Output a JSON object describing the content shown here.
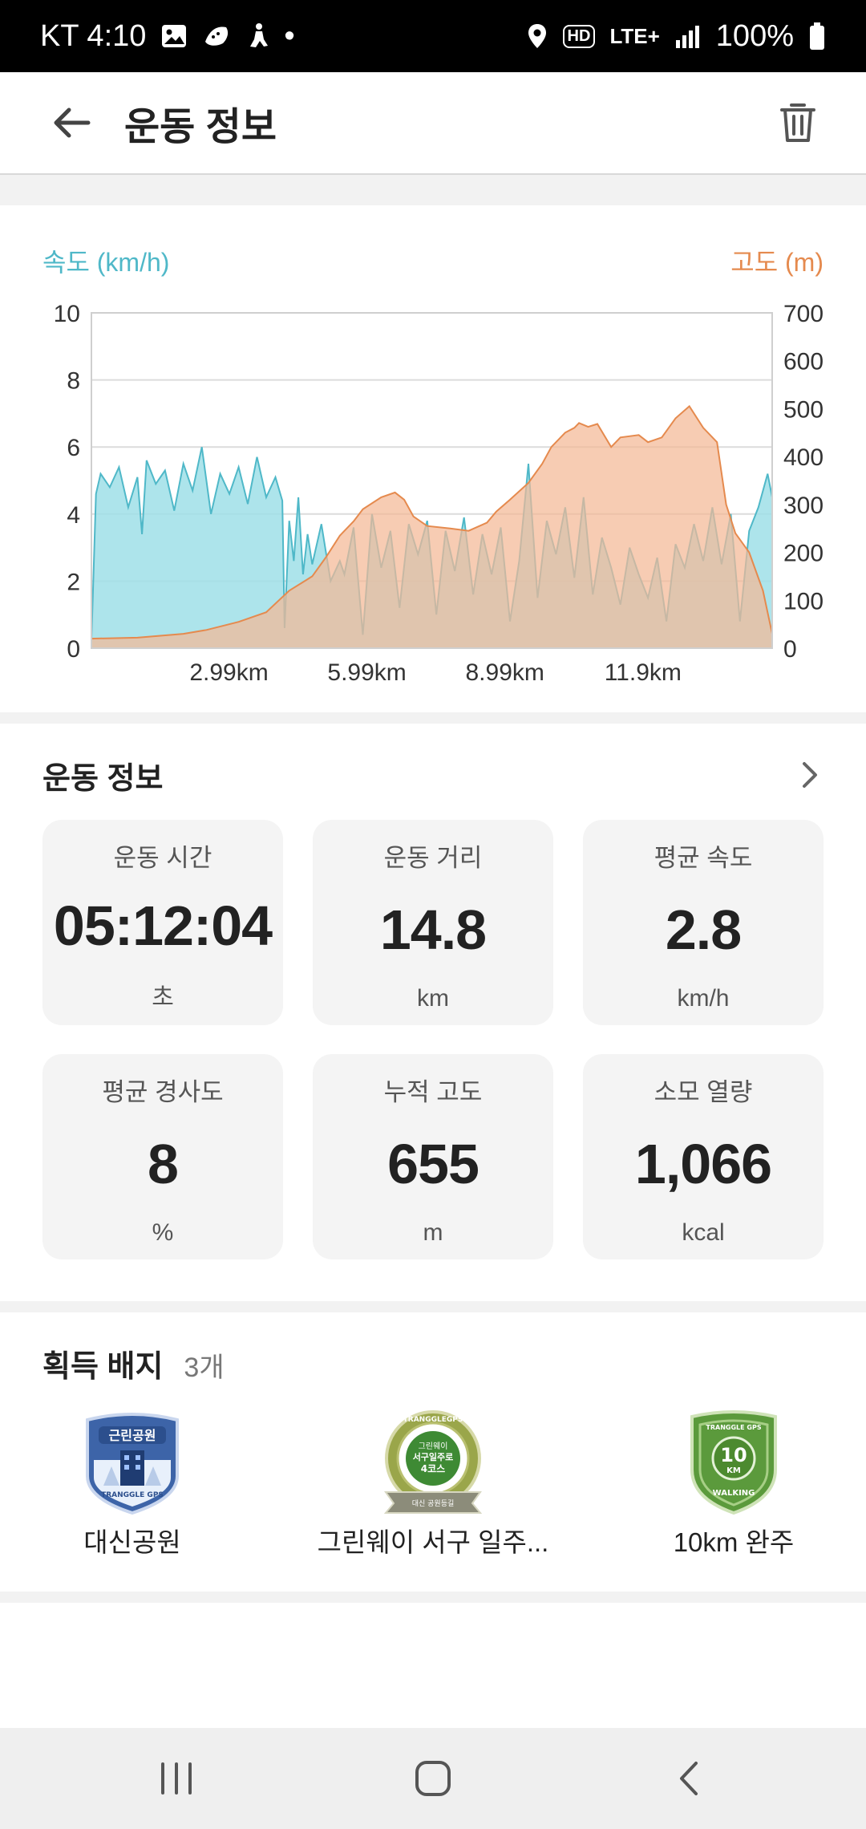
{
  "status_bar": {
    "carrier_time": "KT 4:10",
    "dot": "•",
    "hd": "HD",
    "network": "LTE+",
    "battery": "100%"
  },
  "header": {
    "title": "운동 정보"
  },
  "chart_data": {
    "type": "area",
    "x_tick_labels": [
      "2.99km",
      "5.99km",
      "8.99km",
      "11.9km"
    ],
    "x_tick_positions": [
      2.99,
      5.99,
      8.99,
      11.99
    ],
    "xlim": [
      0,
      14.8
    ],
    "left_axis": {
      "label": "속도 (km/h)",
      "ylim": [
        0,
        10
      ],
      "ticks": [
        "0",
        "2",
        "4",
        "6",
        "8",
        "10"
      ],
      "color": "#4fb8c8"
    },
    "right_axis": {
      "label": "고도 (m)",
      "ylim": [
        0,
        700
      ],
      "ticks": [
        "0",
        "100",
        "200",
        "300",
        "400",
        "500",
        "600",
        "700"
      ],
      "color": "#e58a4e"
    },
    "grid": true,
    "series": [
      {
        "axis": "left",
        "color": "#9fdfe7",
        "x": [
          0,
          0.1,
          0.2,
          0.4,
          0.6,
          0.8,
          1.0,
          1.1,
          1.2,
          1.4,
          1.6,
          1.8,
          2.0,
          2.2,
          2.4,
          2.6,
          2.8,
          3.0,
          3.2,
          3.4,
          3.6,
          3.8,
          4.0,
          4.15,
          4.2,
          4.3,
          4.4,
          4.5,
          4.6,
          4.7,
          4.8,
          5.0,
          5.2,
          5.4,
          5.5,
          5.7,
          5.9,
          6.1,
          6.3,
          6.5,
          6.7,
          6.9,
          7.1,
          7.3,
          7.5,
          7.7,
          7.9,
          8.1,
          8.3,
          8.5,
          8.7,
          8.9,
          9.1,
          9.3,
          9.5,
          9.7,
          9.9,
          10.1,
          10.3,
          10.5,
          10.7,
          10.9,
          11.1,
          11.3,
          11.5,
          11.7,
          11.9,
          12.1,
          12.3,
          12.5,
          12.7,
          12.9,
          13.1,
          13.3,
          13.5,
          13.7,
          13.9,
          14.1,
          14.3,
          14.5,
          14.7,
          14.8
        ],
        "values": [
          0.2,
          4.6,
          5.2,
          4.8,
          5.4,
          4.2,
          5.1,
          3.4,
          5.6,
          4.9,
          5.3,
          4.1,
          5.5,
          4.7,
          6.0,
          4.0,
          5.2,
          4.6,
          5.4,
          4.3,
          5.7,
          4.5,
          5.1,
          4.4,
          0.6,
          3.8,
          2.6,
          4.5,
          2.2,
          3.4,
          2.5,
          3.7,
          2.0,
          2.6,
          2.2,
          3.6,
          0.4,
          4.0,
          2.4,
          3.5,
          1.2,
          3.7,
          2.8,
          3.8,
          1.0,
          3.5,
          2.3,
          3.9,
          1.6,
          3.4,
          2.2,
          3.6,
          0.8,
          2.6,
          5.5,
          1.5,
          3.8,
          2.8,
          4.2,
          2.1,
          4.5,
          1.6,
          3.3,
          2.4,
          1.3,
          3.0,
          2.2,
          1.5,
          2.7,
          0.8,
          3.1,
          2.4,
          3.7,
          2.6,
          4.2,
          2.5,
          4.0,
          0.8,
          3.5,
          4.2,
          5.2,
          4.5
        ]
      },
      {
        "axis": "right",
        "color": "#f4b995",
        "x": [
          0,
          1.0,
          2.0,
          2.5,
          3.2,
          3.8,
          4.3,
          4.8,
          5.1,
          5.4,
          5.7,
          5.9,
          6.3,
          6.6,
          6.8,
          7.0,
          7.3,
          7.8,
          8.2,
          8.6,
          8.8,
          9.1,
          9.5,
          9.8,
          10.0,
          10.3,
          10.5,
          10.6,
          10.8,
          11.0,
          11.3,
          11.5,
          11.9,
          12.1,
          12.4,
          12.7,
          13.0,
          13.3,
          13.6,
          13.8,
          14.0,
          14.3,
          14.6,
          14.8
        ],
        "values": [
          20,
          22,
          30,
          38,
          55,
          75,
          120,
          150,
          190,
          235,
          265,
          290,
          315,
          325,
          310,
          275,
          255,
          250,
          245,
          262,
          285,
          310,
          345,
          385,
          420,
          450,
          460,
          470,
          462,
          468,
          420,
          440,
          445,
          430,
          440,
          480,
          505,
          460,
          430,
          300,
          240,
          200,
          120,
          30
        ]
      }
    ]
  },
  "workout": {
    "section_title": "운동 정보",
    "stats": [
      {
        "label": "운동 시간",
        "value": "05:12:04",
        "unit": "초"
      },
      {
        "label": "운동 거리",
        "value": "14.8",
        "unit": "km"
      },
      {
        "label": "평균 속도",
        "value": "2.8",
        "unit": "km/h"
      },
      {
        "label": "평균 경사도",
        "value": "8",
        "unit": "%"
      },
      {
        "label": "누적 고도",
        "value": "655",
        "unit": "m"
      },
      {
        "label": "소모 열량",
        "value": "1,066",
        "unit": "kcal"
      }
    ]
  },
  "badges": {
    "title": "획득 배지",
    "count": "3개",
    "items": [
      {
        "name": "대신공원",
        "icon": "park-badge-icon",
        "emblem_text_1": "근린공원",
        "emblem_text_2": "TRANGGLE GPS"
      },
      {
        "name": "그린웨이 서구 일주...",
        "icon": "course-medal-icon",
        "emblem_text_1": "그린웨이",
        "emblem_text_2": "서구일주로",
        "emblem_text_3": "4코스",
        "emblem_text_4": "TRANGGLEGPS",
        "emblem_text_5": "대신 공원등길"
      },
      {
        "name": "10km 완주",
        "icon": "walking-shield-icon",
        "emblem_text_1": "10",
        "emblem_text_2": "KM",
        "emblem_text_3": "WALKING",
        "emblem_text_4": "TRANGGLE GPS"
      }
    ]
  }
}
